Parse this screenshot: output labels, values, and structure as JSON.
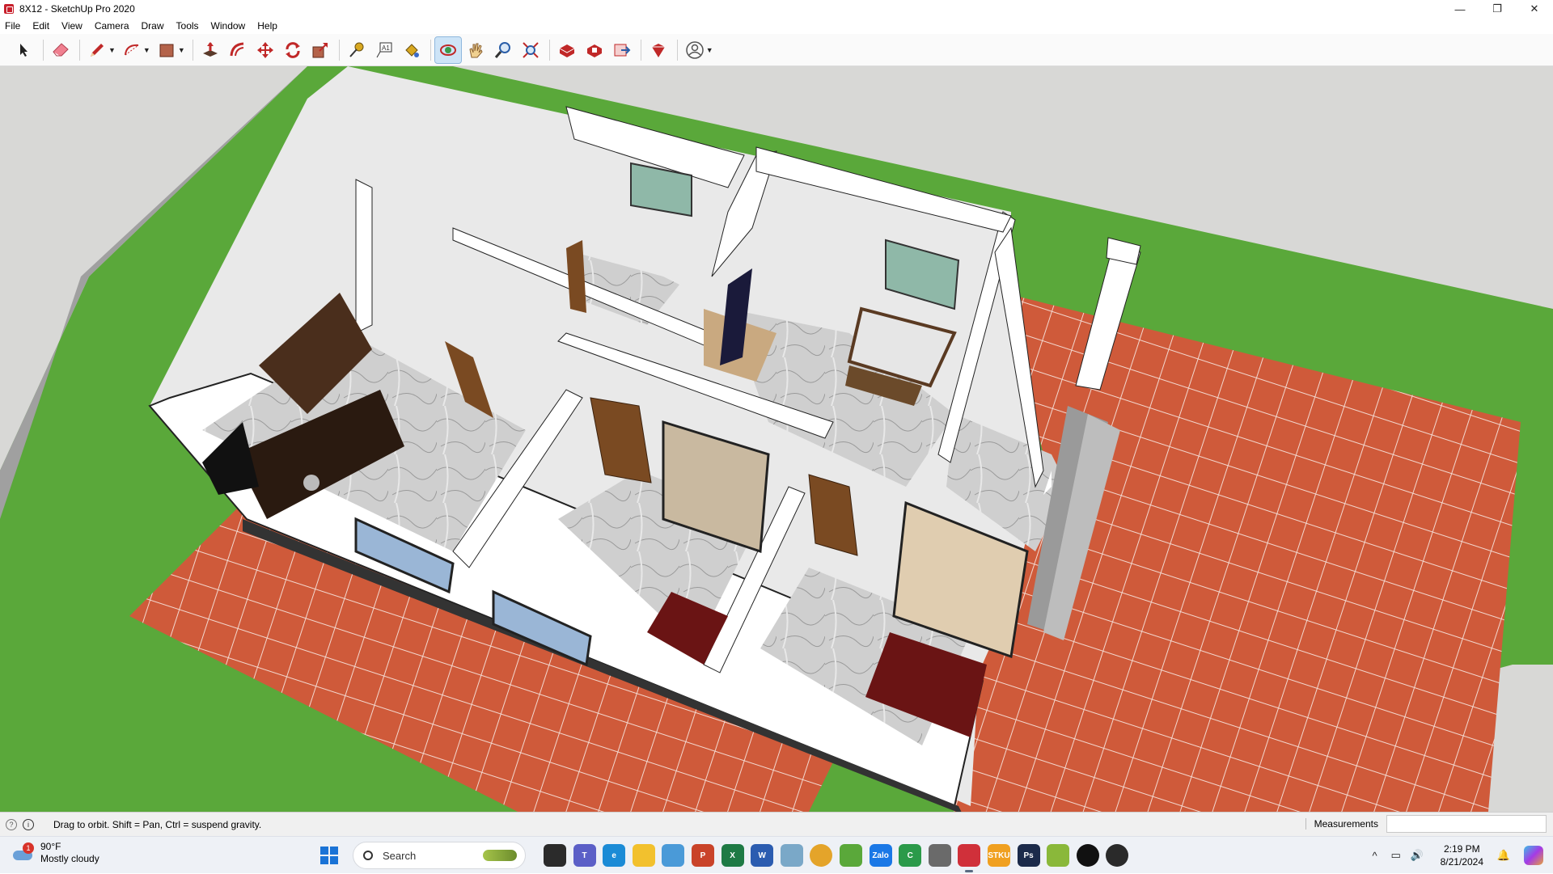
{
  "window": {
    "title": "8X12 - SketchUp Pro 2020",
    "controls": [
      "—",
      "❐",
      "✕"
    ]
  },
  "menu": [
    "File",
    "Edit",
    "View",
    "Camera",
    "Draw",
    "Tools",
    "Window",
    "Help"
  ],
  "toolbar": {
    "tools": [
      {
        "name": "select-tool-icon",
        "color": "#222222"
      },
      {
        "name": "eraser-tool-icon",
        "color": "#e05a6a"
      },
      {
        "name": "pencil-line-tool-icon",
        "color": "#c02828"
      },
      {
        "name": "arc-tool-icon",
        "color": "#c02828"
      },
      {
        "name": "rectangle-shape-tool-icon",
        "color": "#b4634a"
      },
      {
        "name": "push-pull-tool-icon",
        "color": "#c02828"
      },
      {
        "name": "offset-tool-icon",
        "color": "#c02828"
      },
      {
        "name": "move-tool-icon",
        "color": "#c02828"
      },
      {
        "name": "rotate-tool-icon",
        "color": "#c02828"
      },
      {
        "name": "scale-tool-icon",
        "color": "#c02828"
      },
      {
        "name": "tape-measure-tool-icon",
        "color": "#d8a820"
      },
      {
        "name": "text-tool-icon",
        "color": "#333333"
      },
      {
        "name": "paint-bucket-tool-icon",
        "color": "#d8a820"
      },
      {
        "name": "orbit-tool-icon",
        "color": "#3a9a4a"
      },
      {
        "name": "pan-tool-icon",
        "color": "#e0b060"
      },
      {
        "name": "zoom-tool-icon",
        "color": "#2a5ea8"
      },
      {
        "name": "zoom-extents-tool-icon",
        "color": "#2a5ea8"
      },
      {
        "name": "3d-warehouse-icon",
        "color": "#c02828"
      },
      {
        "name": "extension-warehouse-icon",
        "color": "#c02828"
      },
      {
        "name": "send-to-layout-icon",
        "color": "#c02828"
      },
      {
        "name": "extension-manager-icon",
        "color": "#c02828"
      },
      {
        "name": "account-icon",
        "color": "#555555"
      }
    ]
  },
  "status": {
    "message": "Drag to orbit. Shift = Pan, Ctrl = suspend gravity.",
    "measurements_label": "Measurements",
    "measurements_value": ""
  },
  "taskbar": {
    "weather_temp": "90°F",
    "weather_desc": "Mostly cloudy",
    "weather_badge": "1",
    "search_placeholder": "Search",
    "time": "2:19 PM",
    "date": "8/21/2024",
    "apps": [
      {
        "name": "task-view-icon",
        "color": "#2b2b2b",
        "label": ""
      },
      {
        "name": "teams-icon",
        "color": "#5b5fc7",
        "label": "T"
      },
      {
        "name": "edge-icon",
        "color": "#1b8bd6",
        "label": "e"
      },
      {
        "name": "file-explorer-icon",
        "color": "#f2c12e",
        "label": ""
      },
      {
        "name": "photos-icon",
        "color": "#4a9ad8",
        "label": ""
      },
      {
        "name": "powerpoint-icon",
        "color": "#c9432a",
        "label": "P"
      },
      {
        "name": "excel-icon",
        "color": "#1e7a45",
        "label": "X"
      },
      {
        "name": "word-icon",
        "color": "#2b5cb0",
        "label": "W"
      },
      {
        "name": "app-icon",
        "color": "#7aa8c8",
        "label": ""
      },
      {
        "name": "chrome-icon",
        "color": "#e4a42a",
        "label": ""
      },
      {
        "name": "coccoc-icon",
        "color": "#5aa83a",
        "label": ""
      },
      {
        "name": "zalo-icon",
        "color": "#1a78e6",
        "label": "Zalo"
      },
      {
        "name": "camtasia-icon",
        "color": "#2b9a4a",
        "label": "C"
      },
      {
        "name": "settings-app-icon",
        "color": "#6a6a6a",
        "label": ""
      },
      {
        "name": "sketchup-icon",
        "color": "#d0303a",
        "label": ""
      },
      {
        "name": "stickies-icon",
        "color": "#f0a020",
        "label": "STKU"
      },
      {
        "name": "photoshop-icon",
        "color": "#1b2a4a",
        "label": "Ps"
      },
      {
        "name": "bluestacks-icon",
        "color": "#8ab83a",
        "label": ""
      },
      {
        "name": "capcut-icon",
        "color": "#111111",
        "label": ""
      },
      {
        "name": "obs-icon",
        "color": "#2a2a2a",
        "label": ""
      }
    ],
    "tray": [
      "^",
      "▭",
      "🔊"
    ]
  },
  "colors": {
    "grass": "#5aa83a",
    "tile": "#cf5a3a",
    "wall": "#ffffff",
    "floor": "#cfcfcf",
    "wood": "#6b3f22",
    "bed": "#6a1414",
    "sky_bg": "#d8d8d6"
  }
}
